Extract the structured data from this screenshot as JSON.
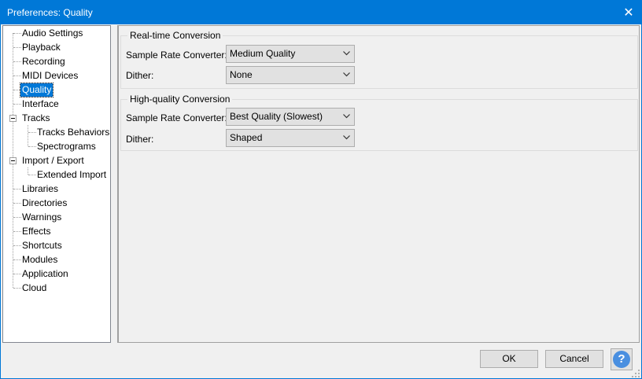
{
  "window": {
    "title": "Preferences: Quality",
    "close_glyph": "✕"
  },
  "tree": {
    "items": [
      {
        "label": "Audio Settings"
      },
      {
        "label": "Playback"
      },
      {
        "label": "Recording"
      },
      {
        "label": "MIDI Devices"
      },
      {
        "label": "Quality",
        "selected": true
      },
      {
        "label": "Interface"
      },
      {
        "label": "Tracks",
        "expanded": true
      },
      {
        "label": "Tracks Behaviors"
      },
      {
        "label": "Spectrograms"
      },
      {
        "label": "Import / Export",
        "expanded": true
      },
      {
        "label": "Extended Import"
      },
      {
        "label": "Libraries"
      },
      {
        "label": "Directories"
      },
      {
        "label": "Warnings"
      },
      {
        "label": "Effects"
      },
      {
        "label": "Shortcuts"
      },
      {
        "label": "Modules"
      },
      {
        "label": "Application"
      },
      {
        "label": "Cloud"
      }
    ]
  },
  "realtime": {
    "title": "Real-time Conversion",
    "src_label": "Sample Rate Converter:",
    "src_value": "Medium Quality",
    "dither_label": "Dither:",
    "dither_value": "None"
  },
  "highquality": {
    "title": "High-quality Conversion",
    "src_label": "Sample Rate Converter:",
    "src_value": "Best Quality (Slowest)",
    "dither_label": "Dither:",
    "dither_value": "Shaped"
  },
  "buttons": {
    "ok": "OK",
    "cancel": "Cancel",
    "help": "?"
  }
}
